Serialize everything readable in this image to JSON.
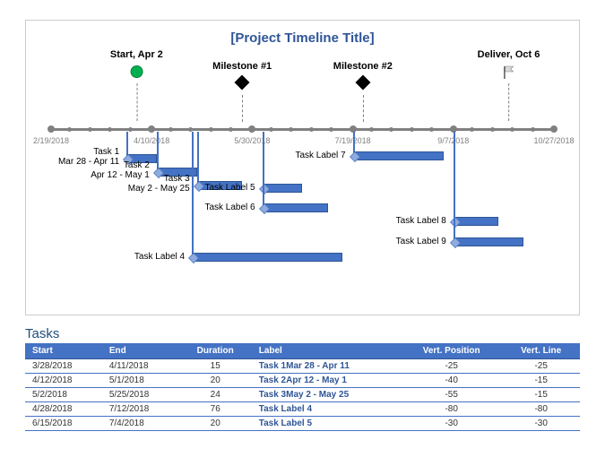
{
  "chart_data": {
    "type": "timeline",
    "title": "[Project Timeline Title]",
    "axis": {
      "start": "2/19/2018",
      "end": "10/27/2018",
      "ticks": [
        {
          "label": "2/19/2018",
          "pct": 0
        },
        {
          "label": "4/10/2018",
          "pct": 20
        },
        {
          "label": "5/30/2018",
          "pct": 40
        },
        {
          "label": "7/19/2018",
          "pct": 60
        },
        {
          "label": "9/7/2018",
          "pct": 80
        },
        {
          "label": "10/27/2018",
          "pct": 100
        }
      ],
      "minor_ticks_pct": [
        4,
        8,
        12,
        16,
        24,
        28,
        32,
        36,
        44,
        48,
        52,
        56,
        64,
        68,
        72,
        76,
        84,
        88,
        92,
        96
      ]
    },
    "milestones": [
      {
        "label": "Start, Apr 2",
        "pct": 17,
        "marker": "circle"
      },
      {
        "label": "Milestone #1",
        "pct": 38,
        "marker": "diamond",
        "short": true
      },
      {
        "label": "Milestone #2",
        "pct": 62,
        "marker": "diamond",
        "short": true
      },
      {
        "label": "Deliver, Oct 6",
        "pct": 91,
        "marker": "flag"
      }
    ],
    "tasks_visual": [
      {
        "label": "Task 1",
        "sub": "Mar 28 - Apr 11",
        "start_pct": 15,
        "dur_pct": 6,
        "drop": 25
      },
      {
        "label": "Task 2",
        "sub": "Apr 12 - May 1",
        "start_pct": 21,
        "dur_pct": 8,
        "drop": 40
      },
      {
        "label": "Task 3",
        "sub": "May 2 - May 25",
        "start_pct": 29,
        "dur_pct": 9,
        "drop": 55
      },
      {
        "label": "Task Label 4",
        "sub": "",
        "start_pct": 28,
        "dur_pct": 30,
        "drop": 135
      },
      {
        "label": "Task Label 5",
        "sub": "",
        "start_pct": 42,
        "dur_pct": 8,
        "drop": 58
      },
      {
        "label": "Task Label 6",
        "sub": "",
        "start_pct": 42,
        "dur_pct": 13,
        "drop": 80
      },
      {
        "label": "Task Label 7",
        "sub": "",
        "start_pct": 60,
        "dur_pct": 18,
        "drop": 22
      },
      {
        "label": "Task Label 8",
        "sub": "",
        "start_pct": 80,
        "dur_pct": 9,
        "drop": 95
      },
      {
        "label": "Task Label 9",
        "sub": "",
        "start_pct": 80,
        "dur_pct": 14,
        "drop": 118
      }
    ]
  },
  "tasks_section": {
    "title": "Tasks",
    "headers": [
      "Start",
      "End",
      "Duration",
      "Label",
      "Vert. Position",
      "Vert. Line"
    ],
    "rows": [
      {
        "start": "3/28/2018",
        "end": "4/11/2018",
        "dur": "15",
        "label": "Task 1Mar 28 - Apr 11",
        "vpos": "-25",
        "vline": "-25"
      },
      {
        "start": "4/12/2018",
        "end": "5/1/2018",
        "dur": "20",
        "label": "Task 2Apr 12 - May 1",
        "vpos": "-40",
        "vline": "-15"
      },
      {
        "start": "5/2/2018",
        "end": "5/25/2018",
        "dur": "24",
        "label": "Task 3May 2 - May 25",
        "vpos": "-55",
        "vline": "-15"
      },
      {
        "start": "4/28/2018",
        "end": "7/12/2018",
        "dur": "76",
        "label": "Task Label 4",
        "vpos": "-80",
        "vline": "-80"
      },
      {
        "start": "6/15/2018",
        "end": "7/4/2018",
        "dur": "20",
        "label": "Task Label 5",
        "vpos": "-30",
        "vline": "-30"
      }
    ]
  }
}
